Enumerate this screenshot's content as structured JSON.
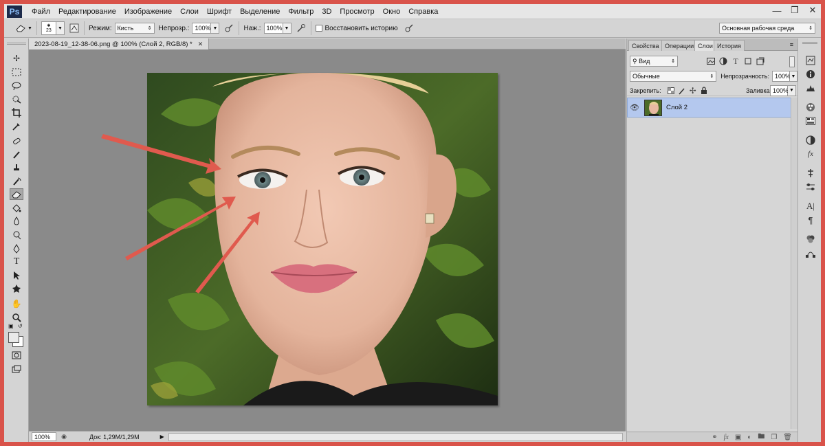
{
  "app": {
    "logo": "Ps",
    "menu": [
      "Файл",
      "Редактирование",
      "Изображение",
      "Слои",
      "Шрифт",
      "Выделение",
      "Фильтр",
      "3D",
      "Просмотр",
      "Окно",
      "Справка"
    ]
  },
  "options": {
    "brush_size": "23",
    "mode_label": "Режим:",
    "mode_value": "Кисть",
    "opacity_label": "Непрозр.:",
    "opacity_value": "100%",
    "pressure_label": "Наж.:",
    "pressure_value": "100%",
    "restore_history_label": "Восстановить историю",
    "workspace": "Основная рабочая среда"
  },
  "document": {
    "tab_title": "2023-08-19_12-38-06.png @ 100% (Слой 2, RGB/8) *",
    "zoom": "100%",
    "doc_size": "Док: 1,29M/1,29M"
  },
  "panels": {
    "tabs": [
      "Свойства",
      "Операции",
      "Слои",
      "История"
    ],
    "active_tab": "Слои",
    "filter_kind": "Вид",
    "blend_mode": "Обычные",
    "opacity_label": "Непрозрачность:",
    "opacity_value": "100%",
    "lock_label": "Закрепить:",
    "fill_label": "Заливка:",
    "fill_value": "100%",
    "layers": [
      {
        "name": "Слой 2",
        "visible": true,
        "selected": true
      }
    ]
  },
  "colors": {
    "frame": "#d9534a",
    "selected_layer": "#b4c8ee",
    "arrow": "#e05a4e"
  }
}
